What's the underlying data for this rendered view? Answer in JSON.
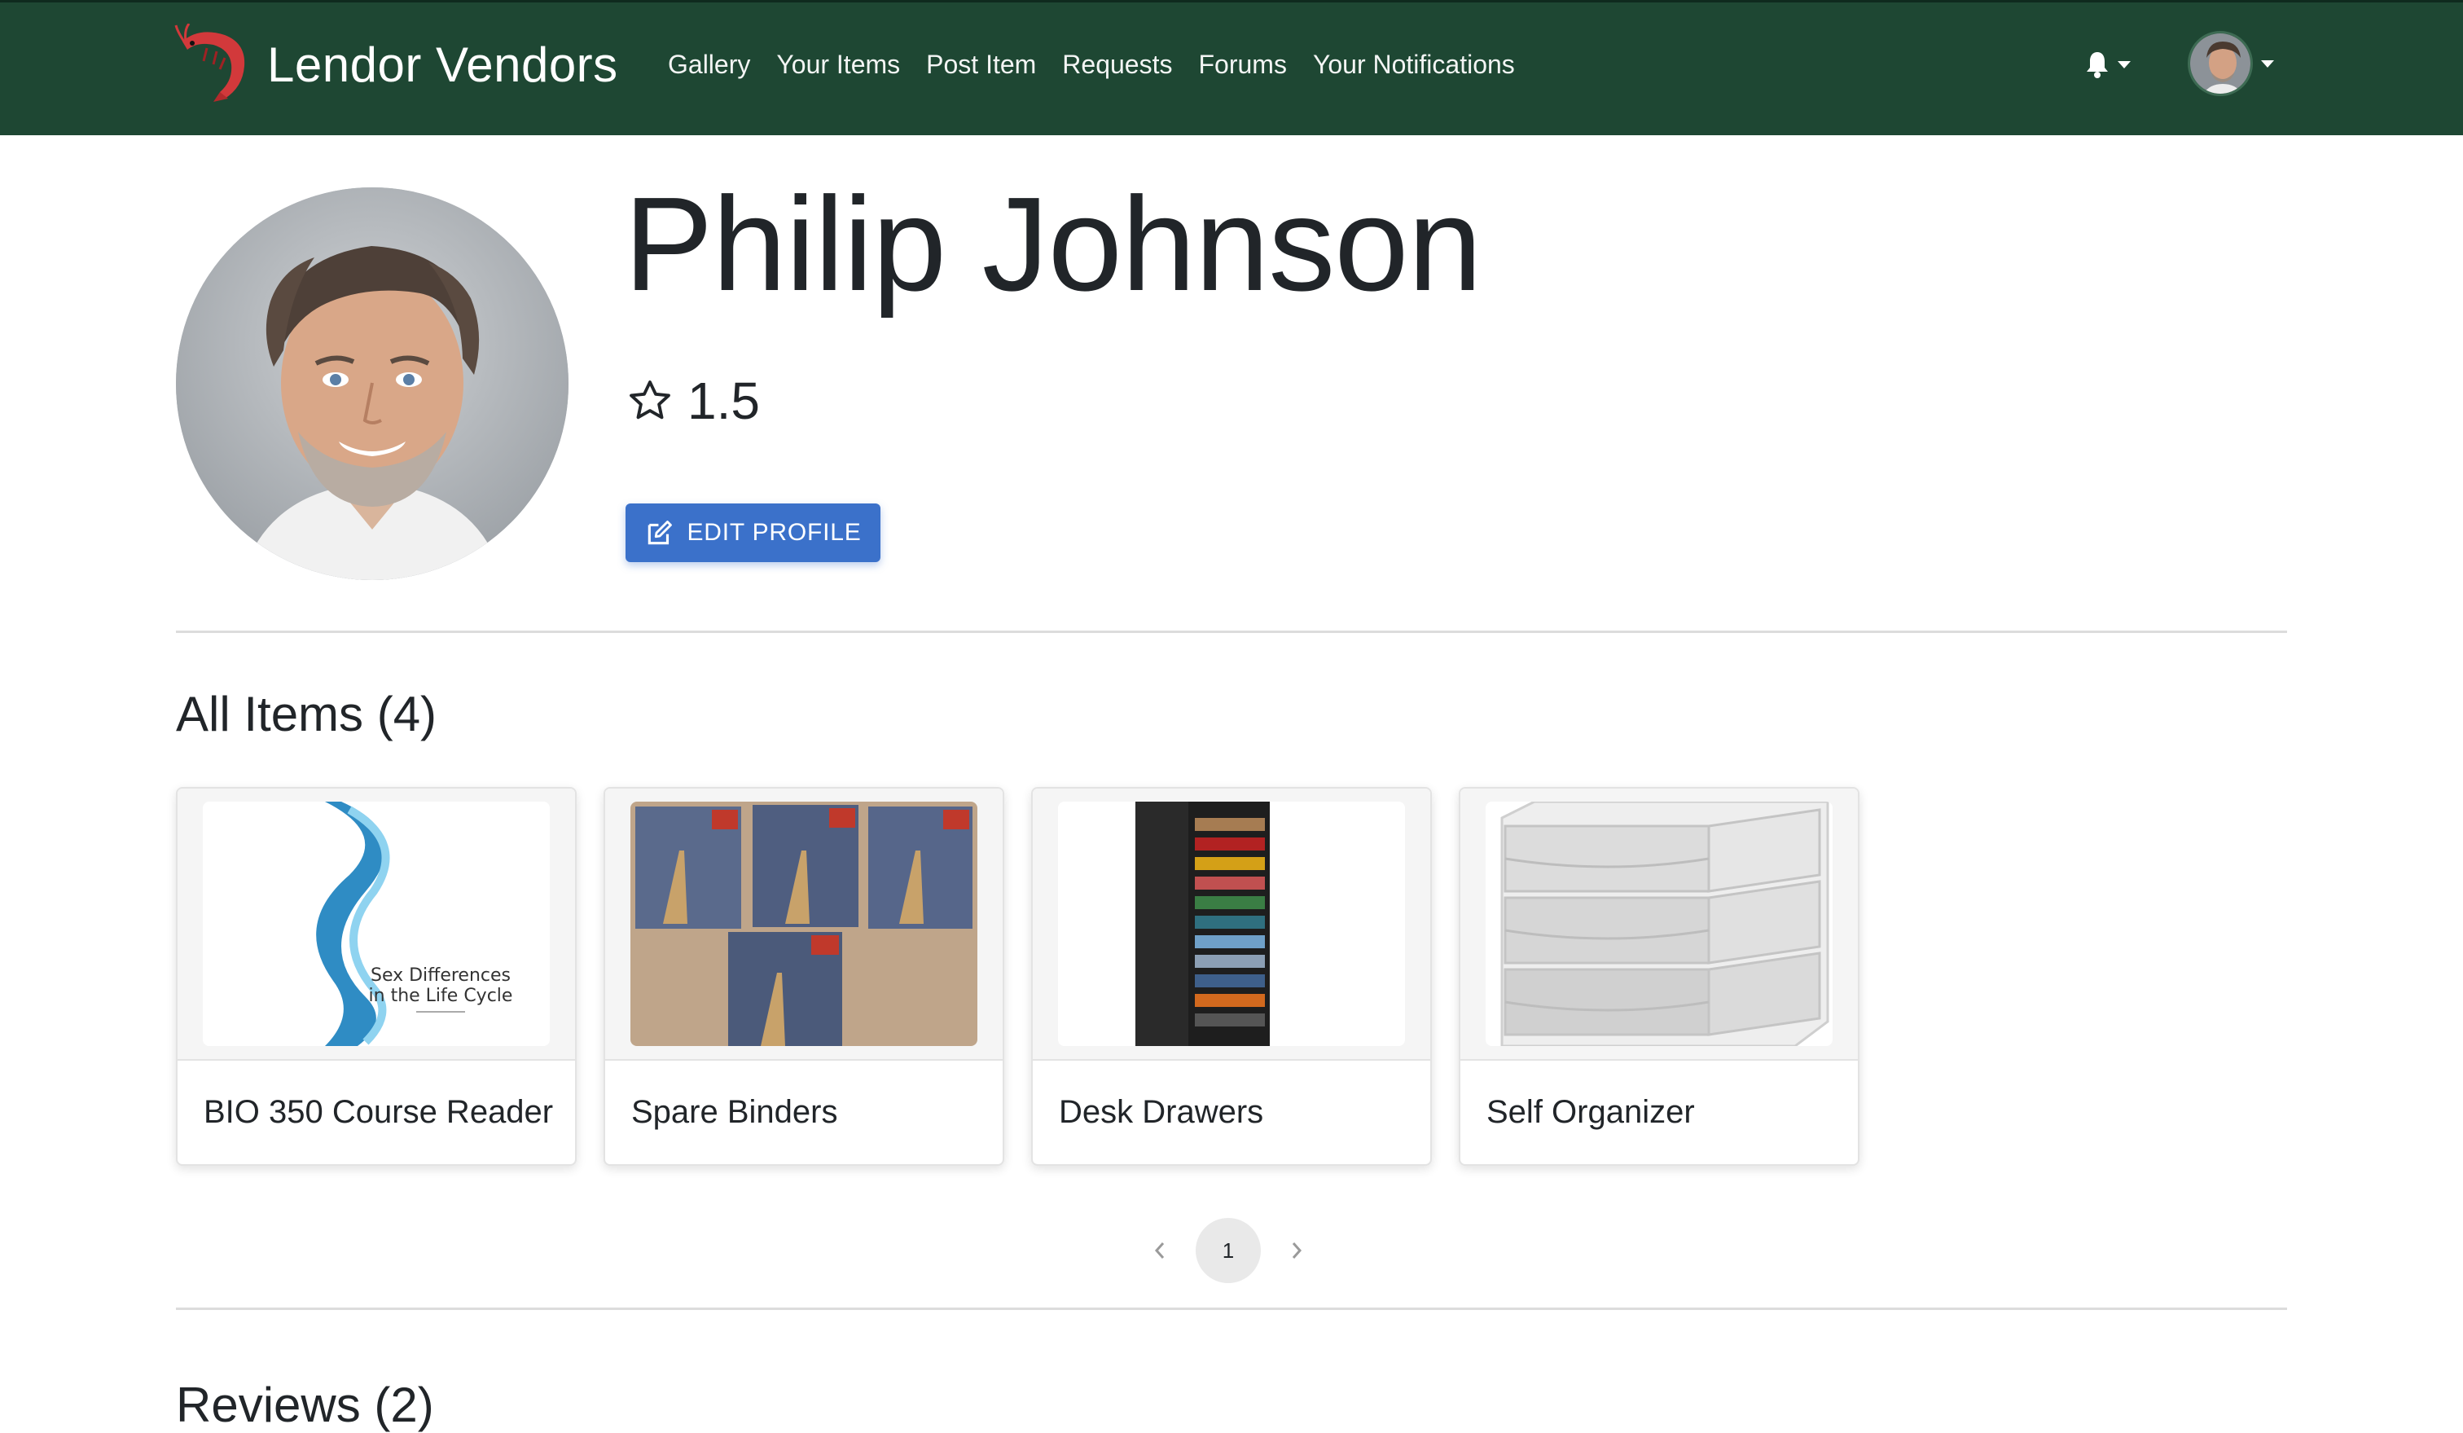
{
  "brand": {
    "name": "Lendor Vendors",
    "logo_icon": "shrimp-icon"
  },
  "nav": {
    "links": [
      "Gallery",
      "Your Items",
      "Post Item",
      "Requests",
      "Forums",
      "Your Notifications"
    ],
    "notification_icon": "bell-icon"
  },
  "profile": {
    "name": "Philip Johnson",
    "rating": "1.5",
    "edit_button_label": "EDIT PROFILE"
  },
  "items_section": {
    "title": "All Items (4)",
    "items": [
      {
        "title": "BIO 350 Course Reader",
        "image_text": [
          "Sex Differences",
          "in the Life Cycle"
        ]
      },
      {
        "title": "Spare Binders"
      },
      {
        "title": "Desk Drawers"
      },
      {
        "title": "Self Organizer"
      }
    ]
  },
  "pagination": {
    "current_page": "1"
  },
  "reviews_section": {
    "title": "Reviews (2)"
  },
  "colors": {
    "navbar": "#1e4733",
    "button": "#3b71ca"
  }
}
